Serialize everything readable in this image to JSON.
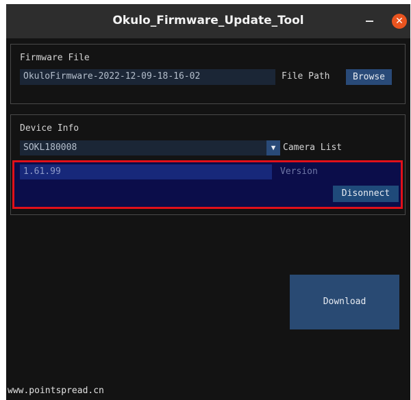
{
  "window": {
    "title": "Okulo_Firmware_Update_Tool"
  },
  "firmware": {
    "section_label": "Firmware File",
    "file_name": "OkuloFirmware-2022-12-09-18-16-02",
    "path_label": "File Path",
    "browse_label": "Browse"
  },
  "device": {
    "section_label": "Device Info",
    "selected_camera": "SOKL180008",
    "dropdown_arrow": "▼",
    "camera_list_label": "Camera List",
    "version_value": "1.61.99",
    "version_label": "Version",
    "disconnect_label": "Disonnect"
  },
  "actions": {
    "download_label": "Download"
  },
  "footer": {
    "website": "www.pointspread.cn"
  },
  "colors": {
    "accent": "#294a78",
    "highlight_border": "#e1101a",
    "close_button": "#e9541f"
  }
}
